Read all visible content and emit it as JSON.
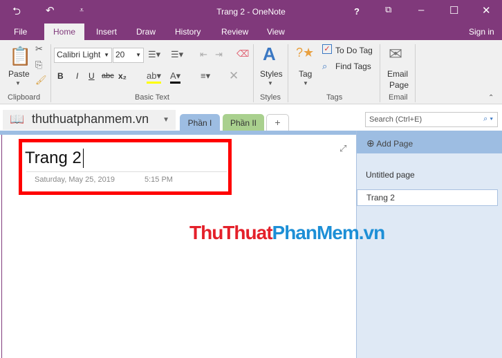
{
  "window": {
    "title": "Trang 2 - OneNote",
    "help": "?",
    "signin": "Sign in"
  },
  "menu": [
    "File",
    "Home",
    "Insert",
    "Draw",
    "History",
    "Review",
    "View"
  ],
  "ribbon": {
    "paste": "Paste",
    "clipboard": "Clipboard",
    "font": "Calibri Light",
    "size": "20",
    "basic_text": "Basic Text",
    "bold": "B",
    "italic": "I",
    "underline": "U",
    "strike": "abc",
    "sub": "x₂",
    "styles": "Styles",
    "styles_group": "Styles",
    "tag": "Tag",
    "todo": "To Do Tag",
    "find_tags": "Find Tags",
    "tags_group": "Tags",
    "email_line1": "Email",
    "email_line2": "Page",
    "email_group": "Email"
  },
  "notebook": {
    "name": "thuthuatphanmem.vn",
    "sections": [
      "Phần I",
      "Phần II"
    ],
    "add": "+",
    "search_placeholder": "Search (Ctrl+E)"
  },
  "page": {
    "title": "Trang 2",
    "date": "Saturday, May 25, 2019",
    "time": "5:15 PM"
  },
  "pages_panel": {
    "add_page": "Add Page",
    "items": [
      "Untitled page",
      "Trang 2"
    ]
  },
  "watermark": {
    "part1": "ThuThuat",
    "part2": "PhanMem",
    "part3": ".vn"
  },
  "colors": {
    "accent": "#80397b",
    "highlight": "#ff0000"
  }
}
